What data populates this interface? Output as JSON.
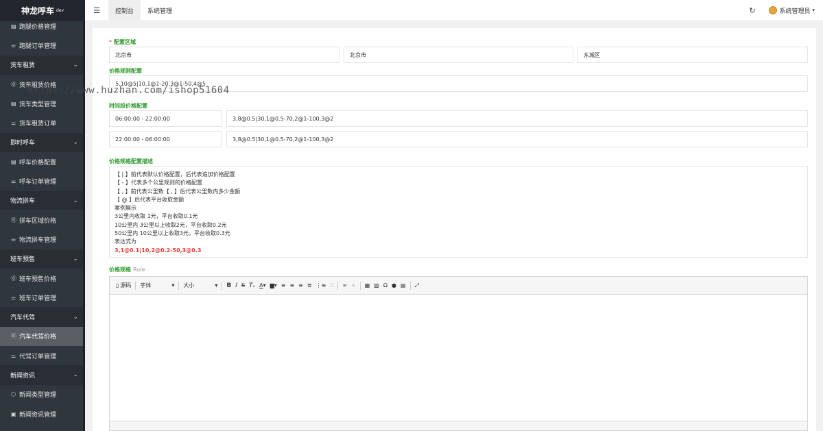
{
  "brand": {
    "name": "神龙呼车",
    "env": "dev"
  },
  "sidebar": {
    "items": [
      {
        "type": "item",
        "icon": "list-icon",
        "glyph": "▤",
        "label": "跑腿价格管理"
      },
      {
        "type": "item",
        "icon": "filter-icon",
        "glyph": "⚌",
        "label": "跑腿订单管理"
      },
      {
        "type": "group",
        "label": "货车租赁"
      },
      {
        "type": "item",
        "icon": "dollar-icon",
        "glyph": "⓪",
        "label": "货车租赁价格"
      },
      {
        "type": "item",
        "icon": "list-icon",
        "glyph": "▤",
        "label": "货车类型管理"
      },
      {
        "type": "item",
        "icon": "filter-icon",
        "glyph": "⚌",
        "label": "货车租赁订单"
      },
      {
        "type": "group",
        "label": "即时呼车"
      },
      {
        "type": "item",
        "icon": "list-icon",
        "glyph": "▤",
        "label": "呼车价格配置"
      },
      {
        "type": "item",
        "icon": "filter-icon",
        "glyph": "⚌",
        "label": "呼车订单管理"
      },
      {
        "type": "group",
        "label": "物流拼车"
      },
      {
        "type": "item",
        "icon": "dollar-icon",
        "glyph": "⓪",
        "label": "拼车区域价格"
      },
      {
        "type": "item",
        "icon": "filter-icon",
        "glyph": "⚌",
        "label": "物流拼车管理"
      },
      {
        "type": "group",
        "label": "班车预售"
      },
      {
        "type": "item",
        "icon": "dollar-icon",
        "glyph": "⓪",
        "label": "班车预售价格"
      },
      {
        "type": "item",
        "icon": "filter-icon",
        "glyph": "⚌",
        "label": "班车订单管理"
      },
      {
        "type": "group",
        "label": "汽车代驾"
      },
      {
        "type": "item",
        "icon": "dollar-icon",
        "glyph": "⓪",
        "label": "汽车代驾价格",
        "active": true
      },
      {
        "type": "item",
        "icon": "filter-icon",
        "glyph": "⚌",
        "label": "代驾订单管理"
      },
      {
        "type": "group",
        "label": "新闻资讯"
      },
      {
        "type": "item",
        "icon": "cube-icon",
        "glyph": "⬡",
        "label": "新闻类型管理"
      },
      {
        "type": "item",
        "icon": "document-icon",
        "glyph": "▣",
        "label": "新闻资讯管理"
      }
    ]
  },
  "topbar": {
    "tabs": [
      {
        "label": "控制台",
        "active": true
      },
      {
        "label": "系统管理"
      }
    ],
    "user": "系统管理员"
  },
  "form": {
    "region_label": "配置区域",
    "region": {
      "province": "北京市",
      "city": "北京市",
      "district": "东城区"
    },
    "price_rule_label": "价格规则配置",
    "price_rule": "5,10@5|10,1@1-20,3@1-50,4@5",
    "time_price_label": "时间段价格配置",
    "time_slots": [
      {
        "range": "06:00:00 - 22:00:00",
        "rule": "3,8@0.5|30,1@0.5-70,2@1-100,3@2"
      },
      {
        "range": "22:00:00 - 06:00:00",
        "rule": "3,8@0.5|30,1@0.5-70,2@1-100,3@2"
      }
    ],
    "desc_label": "价格规格配置描述",
    "desc_lines": [
      "【 | 】前代表默认价格配置，后代表追加价格配置",
      "【 - 】代表多个公里规则的价格配置",
      "【 , 】前代表公里数【 , 】后代表公里数内多少金额",
      "【 @ 】后代表平台收取金额",
      "案例展示",
      "3公里内收取 1元，平台收取0.1元",
      "10公里内 3公里以上收取2元，平台收取0.2元",
      "50公里内 10公里以上收取3元，平台收取0.3元",
      "表达式为"
    ],
    "desc_formula": "3,1@0.1|10,2@0.2-50,3@0.3",
    "rule_label": "价格规格",
    "rule_sub": "Rule",
    "editor": {
      "source": "源码",
      "font": "字体",
      "size": "大小"
    }
  },
  "watermark": "https://www.huzhan.com/ishop51604"
}
